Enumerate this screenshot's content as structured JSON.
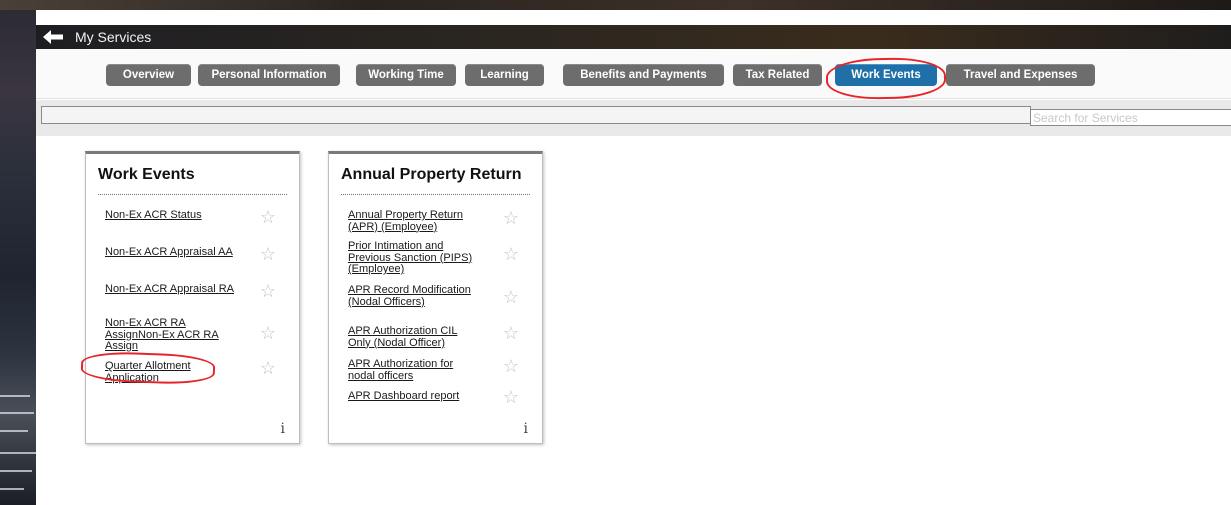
{
  "header": {
    "title": "My Services"
  },
  "tabs": [
    {
      "label": "Overview",
      "active": false
    },
    {
      "label": "Personal Information",
      "active": false
    },
    {
      "label": "Working Time",
      "active": false
    },
    {
      "label": "Learning",
      "active": false
    },
    {
      "label": "Benefits and Payments",
      "active": false
    },
    {
      "label": "Tax Related",
      "active": false
    },
    {
      "label": "Work Events",
      "active": true
    },
    {
      "label": "Travel and Expenses",
      "active": false
    }
  ],
  "search": {
    "placeholder": "Search for Services"
  },
  "cards": [
    {
      "title": "Work Events",
      "items": [
        "Non-Ex ACR Status",
        "Non-Ex ACR Appraisal AA",
        "Non-Ex ACR Appraisal RA",
        "Non-Ex ACR RA AssignNon-Ex ACR RA Assign",
        "Quarter Allotment Application"
      ],
      "info": "i"
    },
    {
      "title": "Annual Property Return",
      "items": [
        "Annual Property Return (APR) (Employee)",
        "Prior Intimation and Previous Sanction (PIPS) (Employee)",
        "APR Record Modification (Nodal Officers)",
        "APR Authorization CIL Only (Nodal Officer)",
        "APR Authorization for nodal officers",
        "APR Dashboard report"
      ],
      "info": "i"
    }
  ],
  "colors": {
    "active_tab": "#1f6fa8",
    "tab": "#6d6d6d",
    "annotation": "#e8242b"
  },
  "icons": {
    "back": "arrow-left-icon",
    "favorite": "star-outline-icon",
    "info": "info-icon"
  }
}
